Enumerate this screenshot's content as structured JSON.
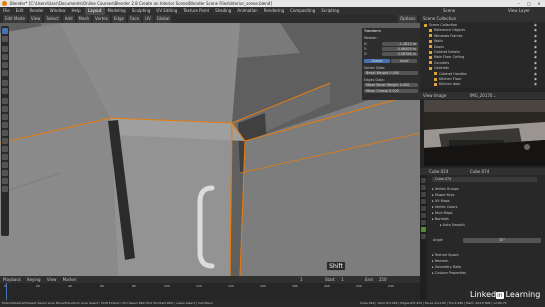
{
  "window": {
    "title": "Blender* [C:\\Users\\User\\Documents\\Online Courses\\Blender 2.8 Create an Interior Scene\\Blender Scene Files\\Interior_scene.blend]",
    "controls": [
      "–",
      "□",
      "×"
    ]
  },
  "menu": {
    "items": [
      "File",
      "Edit",
      "Render",
      "Window",
      "Help"
    ],
    "workspaces": [
      "Layout",
      "Modeling",
      "Sculpting",
      "UV Editing",
      "Texture Paint",
      "Shading",
      "Animation",
      "Rendering",
      "Compositing",
      "Scripting"
    ],
    "active_workspace": "Layout",
    "scene": "Scene",
    "view_layer": "View Layer"
  },
  "viewport_header": {
    "items": [
      "Edit Mode",
      "View",
      "Select",
      "Add",
      "Mesh",
      "Vertex",
      "Edge",
      "Face",
      "UV"
    ],
    "transform": "Global",
    "options": "Options"
  },
  "npanel": {
    "title": "Transform",
    "median_label": "Median:",
    "x_label": "X:",
    "x_value": "-1.2813 m",
    "y_label": "Y:",
    "y_value": "-0.46409 m",
    "z_label": "Z:",
    "z_value": "0.56768 m",
    "space_global": "Global",
    "space_local": "Local",
    "vertex_bevel_weight_label": "Vertex Data:",
    "bevel_weight_label": "Bevel Weight",
    "bevel_weight_value": "0.000",
    "edge_data_label": "Edges Data:",
    "mean_bevel_label": "Mean Bevel Weight",
    "mean_bevel_value": "0.000",
    "mean_crease_label": "Mean Crease",
    "mean_crease_value": "0.000"
  },
  "key_overlay": "Shift",
  "outliner": {
    "title": "Scene Collection",
    "items": [
      {
        "label": "Scene Collection",
        "indent": 0
      },
      {
        "label": "Reference Objects",
        "indent": 1
      },
      {
        "label": "Windows Frames",
        "indent": 1
      },
      {
        "label": "Walls",
        "indent": 1
      },
      {
        "label": "Doors",
        "indent": 1
      },
      {
        "label": "Cabinet Details",
        "indent": 1
      },
      {
        "label": "Main Floor Ceiling",
        "indent": 1
      },
      {
        "label": "Counters",
        "indent": 1
      },
      {
        "label": "Cabinets",
        "indent": 1
      },
      {
        "label": "Cabinet Handles",
        "indent": 2
      },
      {
        "label": "Kitchen Floor",
        "indent": 2
      },
      {
        "label": "Kitchen door",
        "indent": 2
      }
    ]
  },
  "image_editor": {
    "header": "View  Image",
    "image_name": "IMG_20170..."
  },
  "properties": {
    "object_name": "Cube.024",
    "mesh_name": "Cube.074",
    "sections": [
      "Vertex Groups",
      "Shape Keys",
      "UV Maps",
      "Vertex Colors",
      "Face Maps",
      "Normals",
      "Auto Smooth",
      "Texture Space",
      "Remesh",
      "Geometry Data",
      "Custom Properties"
    ],
    "angle_label": "Angle",
    "angle_value": "30°"
  },
  "timeline": {
    "menu": [
      "Playback",
      "Keying",
      "View",
      "Marker"
    ],
    "start_label": "Start",
    "start_value": "1",
    "end_label": "End",
    "end_value": "250",
    "current_frame": "1",
    "ticks": [
      "0",
      "20",
      "40",
      "60",
      "80",
      "100",
      "120",
      "140",
      "160",
      "180",
      "200",
      "220",
      "240"
    ]
  },
  "status": {
    "text": "Extend/Subtract/Select   Select Loop   Move/Transform   Loop Select / Shift Extend / Ctrl Select Path   Pick Shortest Path  |  Lasso Select  |  Call Menu",
    "stats": "Cube.024 | Verts 8/3,256 | Edges 8/5,424 | Faces 2/2,184 | Tris 6,386 | Mem: 293.0 MiB | v2.80.75"
  },
  "branding": {
    "linked": "Linked",
    "in": "in",
    "learning": "Learning"
  },
  "colors": {
    "accent": "#4772b3",
    "selection": "#e87d0d",
    "brand_orange": "#e87d0d"
  }
}
